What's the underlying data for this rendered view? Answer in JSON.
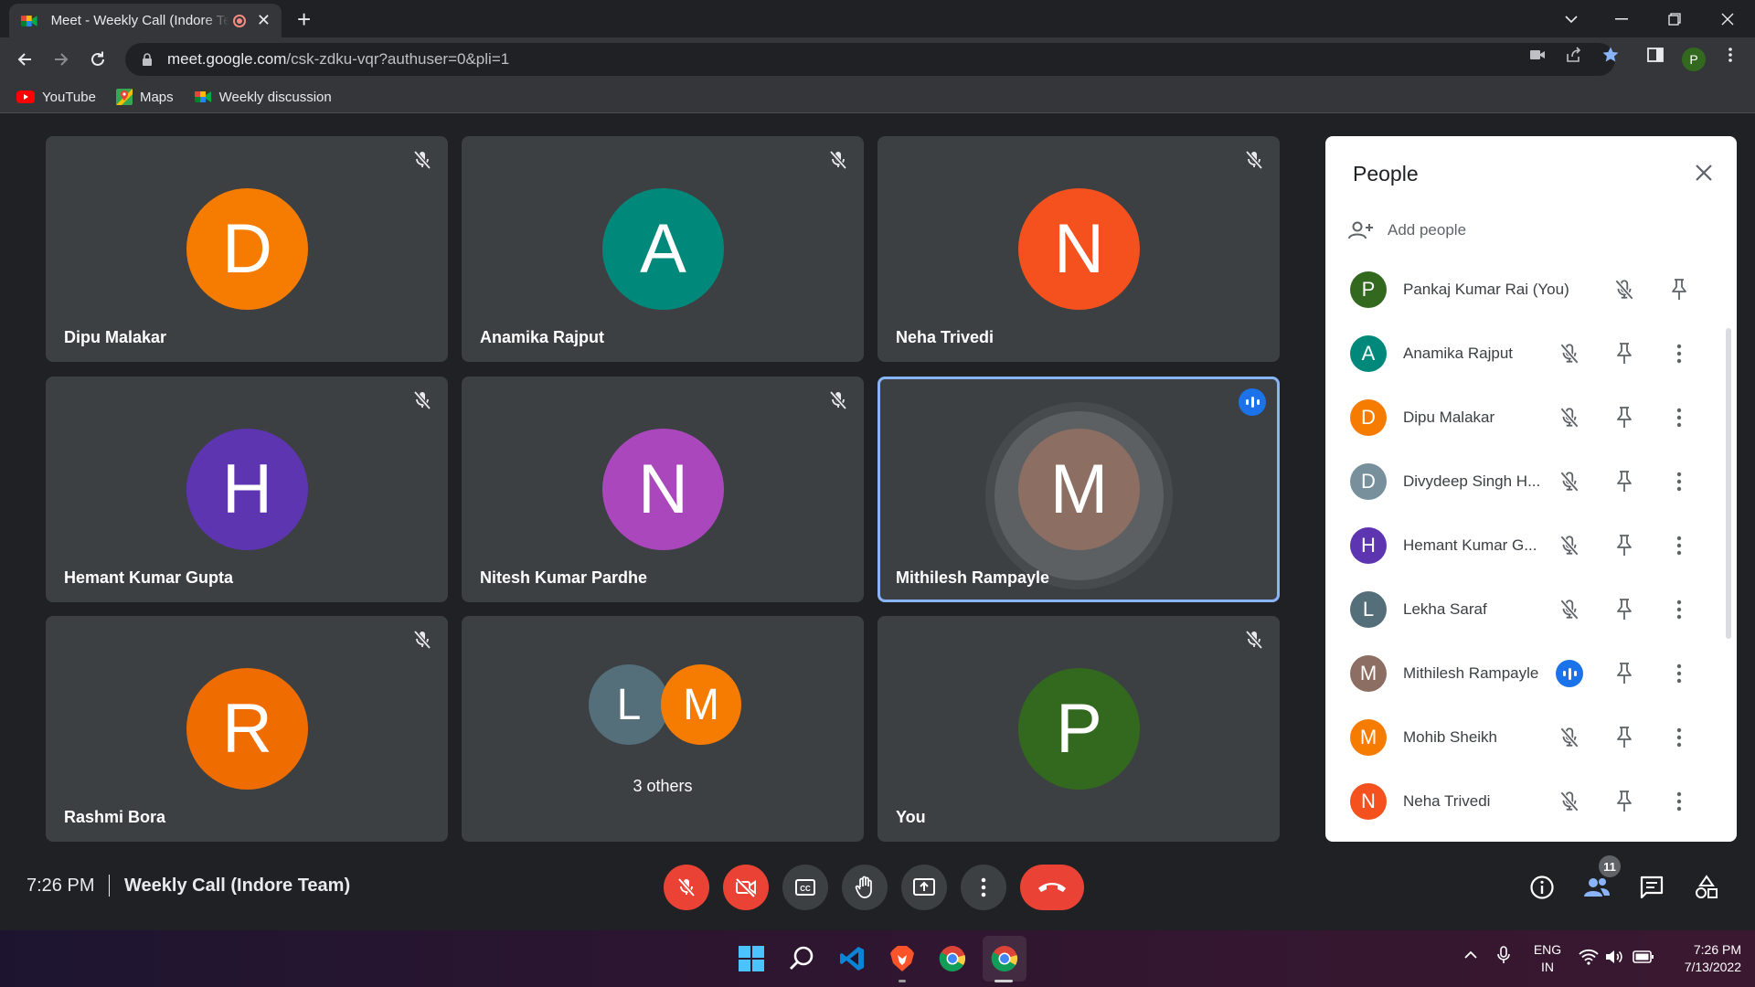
{
  "browser": {
    "tab_title": "Meet - Weekly Call (Indore Team)",
    "url_host": "meet.google.com",
    "url_path": "/csk-zdku-vqr?authuser=0&pli=1",
    "profile_initial": "P",
    "bookmarks": [
      {
        "label": "YouTube",
        "icon": "youtube-icon"
      },
      {
        "label": "Maps",
        "icon": "maps-icon"
      },
      {
        "label": "Weekly discussion",
        "icon": "meet-icon"
      }
    ]
  },
  "tiles": [
    {
      "name": "Dipu Malakar",
      "initial": "D",
      "color": "#f57c00",
      "muted": true
    },
    {
      "name": "Anamika Rajput",
      "initial": "A",
      "color": "#00897b",
      "muted": true
    },
    {
      "name": "Neha Trivedi",
      "initial": "N",
      "color": "#f4511e",
      "muted": true
    },
    {
      "name": "Hemant Kumar Gupta",
      "initial": "H",
      "color": "#5e35b1",
      "muted": true
    },
    {
      "name": "Nitesh Kumar Pardhe",
      "initial": "N",
      "color": "#ab47bc",
      "muted": true
    },
    {
      "name": "Mithilesh Rampayle",
      "initial": "M",
      "color": "#8d6e63",
      "muted": false,
      "speaking": true
    },
    {
      "name": "Rashmi Bora",
      "initial": "R",
      "color": "#ef6c00",
      "muted": true
    },
    {
      "name": "",
      "group": true,
      "group_initials": [
        "L",
        "M"
      ],
      "group_colors": [
        "#546e7a",
        "#f57c00"
      ],
      "group_label": "3 others"
    },
    {
      "name": "You",
      "initial": "P",
      "color": "#33691e",
      "muted": true
    }
  ],
  "people_panel": {
    "title": "People",
    "add_people": "Add people",
    "participants": [
      {
        "name": "Pankaj Kumar Rai (You)",
        "initial": "P",
        "color": "#33691e",
        "speaking": false,
        "self": true
      },
      {
        "name": "Anamika Rajput",
        "initial": "A",
        "color": "#00897b",
        "speaking": false
      },
      {
        "name": "Dipu Malakar",
        "initial": "D",
        "color": "#f57c00",
        "speaking": false
      },
      {
        "name": "Divydeep Singh H...",
        "initial": "D",
        "color": "#78909c",
        "speaking": false
      },
      {
        "name": "Hemant Kumar G...",
        "initial": "H",
        "color": "#5e35b1",
        "speaking": false
      },
      {
        "name": "Lekha Saraf",
        "initial": "L",
        "color": "#546e7a",
        "speaking": false
      },
      {
        "name": "Mithilesh Rampayle",
        "initial": "M",
        "color": "#8d6e63",
        "speaking": true
      },
      {
        "name": "Mohib Sheikh",
        "initial": "M",
        "color": "#f57c00",
        "speaking": false
      },
      {
        "name": "Neha Trivedi",
        "initial": "N",
        "color": "#f4511e",
        "speaking": false
      }
    ]
  },
  "bottom_bar": {
    "time": "7:26 PM",
    "meeting_title": "Weekly Call (Indore Team)",
    "people_count": "11"
  },
  "taskbar": {
    "language": "ENG",
    "region": "IN",
    "time": "7:26 PM",
    "date": "7/13/2022"
  }
}
